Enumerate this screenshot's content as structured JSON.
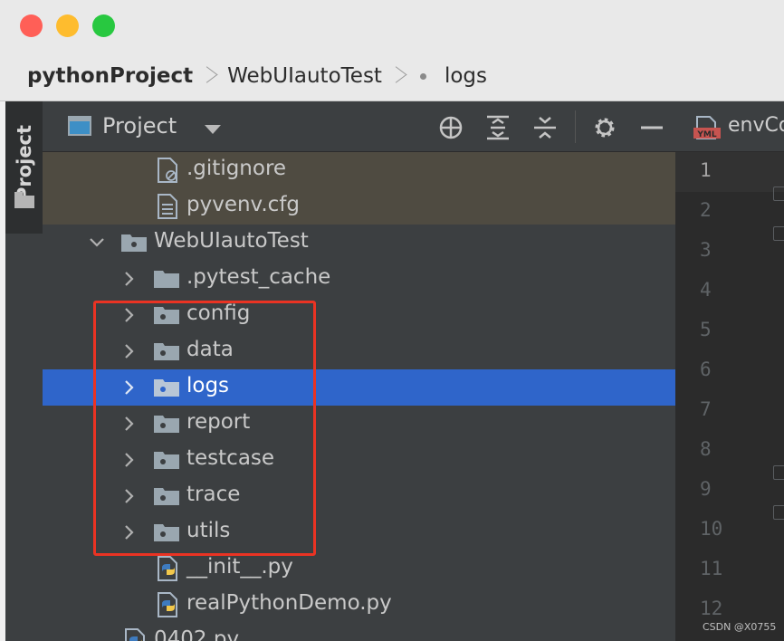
{
  "breadcrumb": {
    "root": "pythonProject",
    "mid": "WebUIautoTest",
    "leaf": "logs"
  },
  "toolstrip": {
    "project_tab": "Project"
  },
  "panel": {
    "title": "Project"
  },
  "tree": {
    "gitignore": ".gitignore",
    "pyvenv": "pyvenv.cfg",
    "webui": "WebUIautoTest",
    "pytest_cache": ".pytest_cache",
    "config": "config",
    "data": "data",
    "logs": "logs",
    "report": "report",
    "testcase": "testcase",
    "trace": "trace",
    "utils": "utils",
    "init": "__init__.py",
    "realdemo": "realPythonDemo.py",
    "partial": "0402.py"
  },
  "editor": {
    "tab_title": "envCo",
    "tab_icon_text": "YML",
    "line_numbers": [
      "1",
      "2",
      "3",
      "4",
      "5",
      "6",
      "7",
      "8",
      "9",
      "10",
      "11",
      "12"
    ],
    "current_line": "1"
  },
  "watermark": "CSDN @X0755",
  "colors": {
    "selection": "#2f65ca",
    "annotation": "#ea3323",
    "excluded_row": "#4f4b41"
  },
  "icons": [
    "folder-icon",
    "file-icon",
    "python-file-icon",
    "gitignore-icon",
    "locate-icon",
    "expand-all-icon",
    "collapse-all-icon",
    "gear-icon",
    "minimize-icon",
    "yml-file-icon"
  ]
}
